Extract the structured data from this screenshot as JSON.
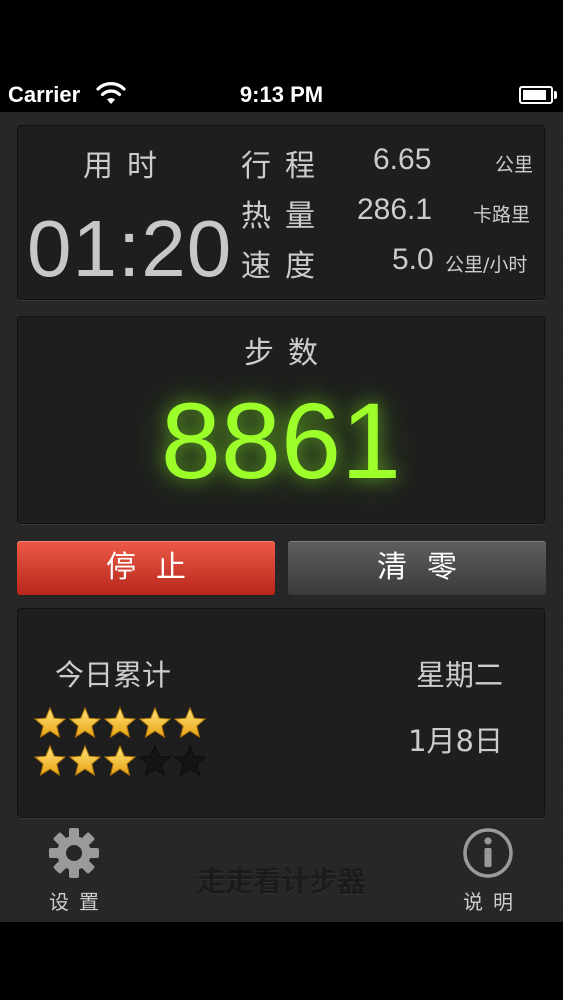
{
  "status_bar": {
    "carrier": "Carrier",
    "time": "9:13 PM",
    "battery_level": 0.9
  },
  "stats": {
    "elapsed_label": "用时",
    "elapsed_time": "01:20",
    "distance_label": "行程",
    "distance_value": "6.65",
    "distance_unit": "公里",
    "calories_label": "热量",
    "calories_value": "286.1",
    "calories_unit": "卡路里",
    "speed_label": "速度",
    "speed_value": "5.0",
    "speed_unit": "公里/小时"
  },
  "steps": {
    "label": "步数",
    "value": "8861",
    "color": "#9cff2a"
  },
  "buttons": {
    "stop_label": "停止",
    "clear_label": "清零",
    "stop_color": "#d9412f"
  },
  "today": {
    "label": "今日累计",
    "weekday": "星期二",
    "date": "1月8日",
    "stars_row1_filled": 5,
    "stars_row2_filled": 3,
    "stars_per_row": 5
  },
  "tabbar": {
    "settings_label": "设置",
    "settings_icon": "gear-icon",
    "app_title": "走走看计步器",
    "help_label": "说明",
    "help_icon": "info-icon"
  }
}
